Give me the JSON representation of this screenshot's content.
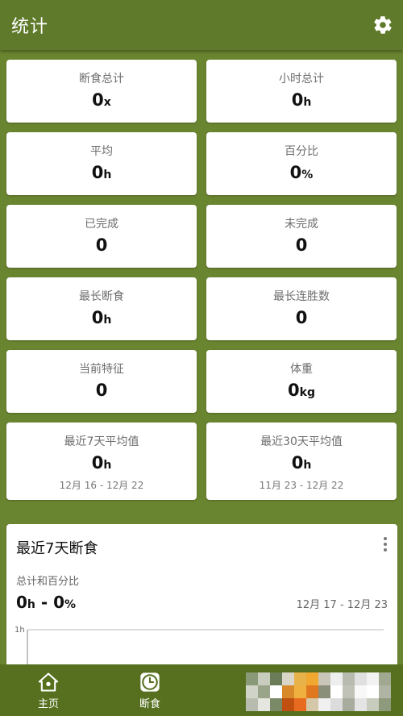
{
  "appbar": {
    "title": "统计"
  },
  "stats": [
    {
      "label": "断食总计",
      "value": "0",
      "unit": "x"
    },
    {
      "label": "小时总计",
      "value": "0",
      "unit": "h"
    },
    {
      "label": "平均",
      "value": "0",
      "unit": "h"
    },
    {
      "label": "百分比",
      "value": "0",
      "unit": "%"
    },
    {
      "label": "已完成",
      "value": "0",
      "unit": ""
    },
    {
      "label": "未完成",
      "value": "0",
      "unit": ""
    },
    {
      "label": "最长断食",
      "value": "0",
      "unit": "h"
    },
    {
      "label": "最长连胜数",
      "value": "0",
      "unit": ""
    },
    {
      "label": "当前特征",
      "value": "0",
      "unit": ""
    },
    {
      "label": "体重",
      "value": "0",
      "unit": "kg"
    },
    {
      "label": "最近7天平均值",
      "value": "0",
      "unit": "h",
      "range": "12月 16 - 12月 22"
    },
    {
      "label": "最近30天平均值",
      "value": "0",
      "unit": "h",
      "range": "11月 23 - 12月 22"
    }
  ],
  "chart_card": {
    "title": "最近7天断食",
    "subtitle": "总计和百分比",
    "summary_hours": "0",
    "summary_hours_unit": "h",
    "summary_separator": " - ",
    "summary_percent": "0",
    "summary_percent_unit": "%",
    "date_range": "12月 17 - 12月 23"
  },
  "chart_data": {
    "type": "bar",
    "categories": [],
    "values": [],
    "y_tick_labels": [
      "1h"
    ],
    "ylim": [
      0,
      1
    ]
  },
  "bottom_nav": {
    "items": [
      {
        "label": "主页",
        "icon": "home-icon"
      },
      {
        "label": "断食",
        "icon": "clock-icon"
      }
    ]
  },
  "colors": {
    "background": "#6a8530",
    "appbar": "#5f7a2a",
    "bottom_nav": "#56701f",
    "card": "#ffffff"
  }
}
